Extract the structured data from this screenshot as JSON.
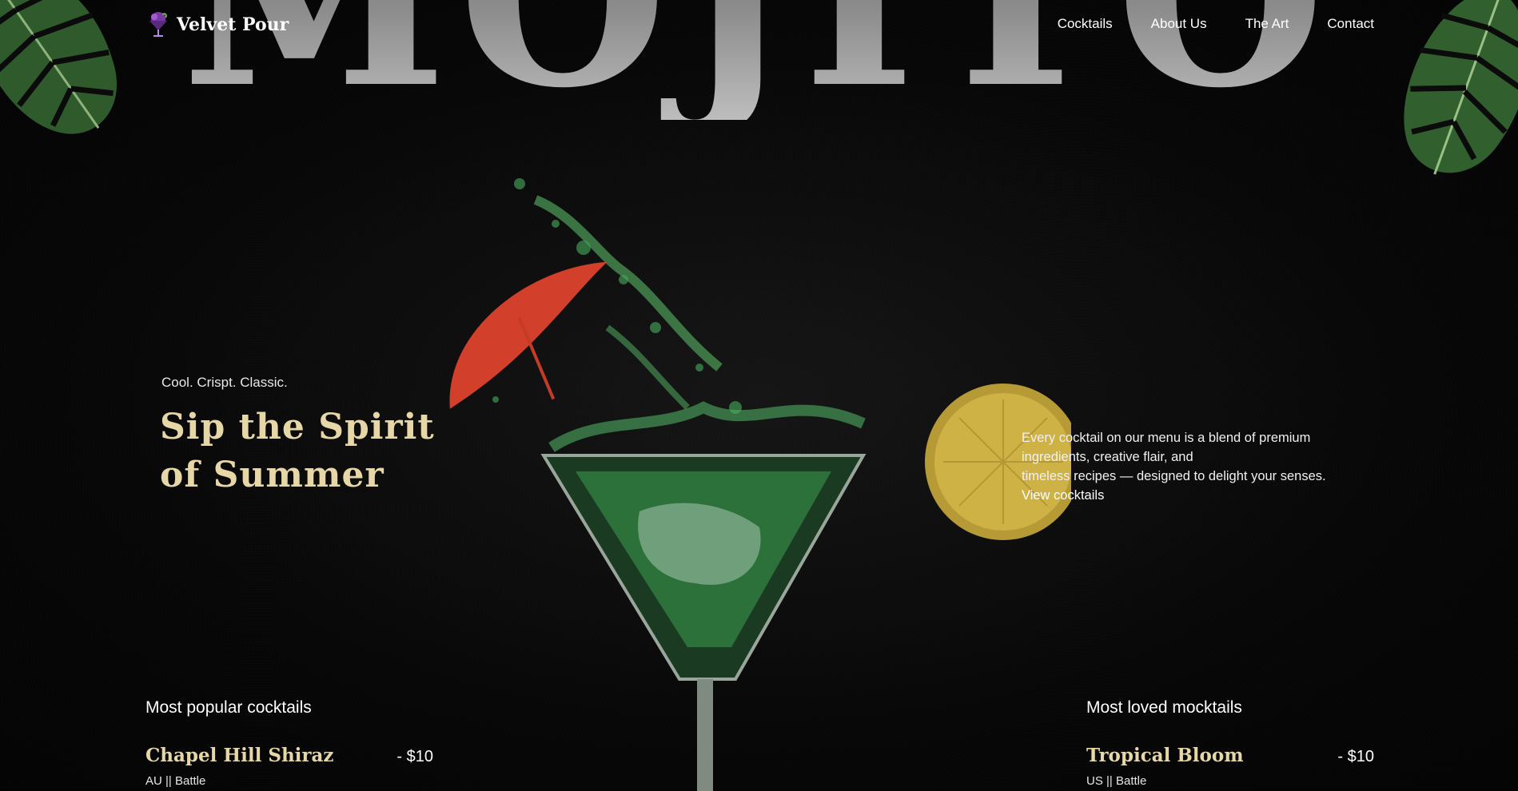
{
  "hero": {
    "word": "MOJITO"
  },
  "nav": {
    "brand": "Velvet Pour",
    "links": [
      "Cocktails",
      "About Us",
      "The Art",
      "Contact"
    ]
  },
  "intro": {
    "tagline": "Cool. Crispt. Classic.",
    "headline_line1": "Sip the Spirit",
    "headline_line2": "of Summer",
    "description_lines": [
      "Every cocktail on our menu is a blend of premium",
      "ingredients, creative flair, and",
      "timeless recipes — designed to delight your senses."
    ],
    "cta": "View cocktails"
  },
  "popular": {
    "title": "Most popular cocktails",
    "items": [
      {
        "name": "Chapel Hill Shiraz",
        "price": "- $10",
        "meta": "AU || Battle"
      }
    ]
  },
  "loved": {
    "title": "Most loved mocktails",
    "items": [
      {
        "name": "Tropical Bloom",
        "price": "- $10",
        "meta": "US || Battle"
      }
    ]
  },
  "colors": {
    "accent": "#e7d7a6",
    "background": "#050505"
  },
  "icons": {
    "logo": "cocktail-glass-icon"
  }
}
